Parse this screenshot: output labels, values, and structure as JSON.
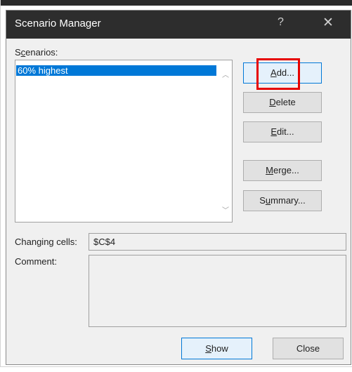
{
  "dialog": {
    "title": "Scenario Manager",
    "help_glyph": "?",
    "close_glyph": "✕"
  },
  "scenarios": {
    "label_before": "S",
    "label_mnemonic": "c",
    "label_after": "enarios:",
    "items": [
      "60% highest"
    ],
    "selected_index": 0,
    "scroll_up_glyph": "︿",
    "scroll_down_glyph": "﹀"
  },
  "buttons": {
    "add": {
      "mnemonic": "A",
      "rest": "dd..."
    },
    "delete": {
      "mnemonic": "D",
      "rest": "elete"
    },
    "edit": {
      "mnemonic": "E",
      "rest": "dit..."
    },
    "merge": {
      "mnemonic": "M",
      "rest": "erge..."
    },
    "summary": {
      "before": "S",
      "mnemonic": "u",
      "rest": "mmary..."
    },
    "show": {
      "mnemonic": "S",
      "rest": "how"
    },
    "close": "Close"
  },
  "changing_cells": {
    "label": "Changing cells:",
    "value": "$C$4"
  },
  "comment": {
    "label": "Comment:",
    "value": ""
  },
  "colors": {
    "titlebar": "#2d2d2d",
    "selection": "#0078d7",
    "highlight": "#e60000"
  }
}
